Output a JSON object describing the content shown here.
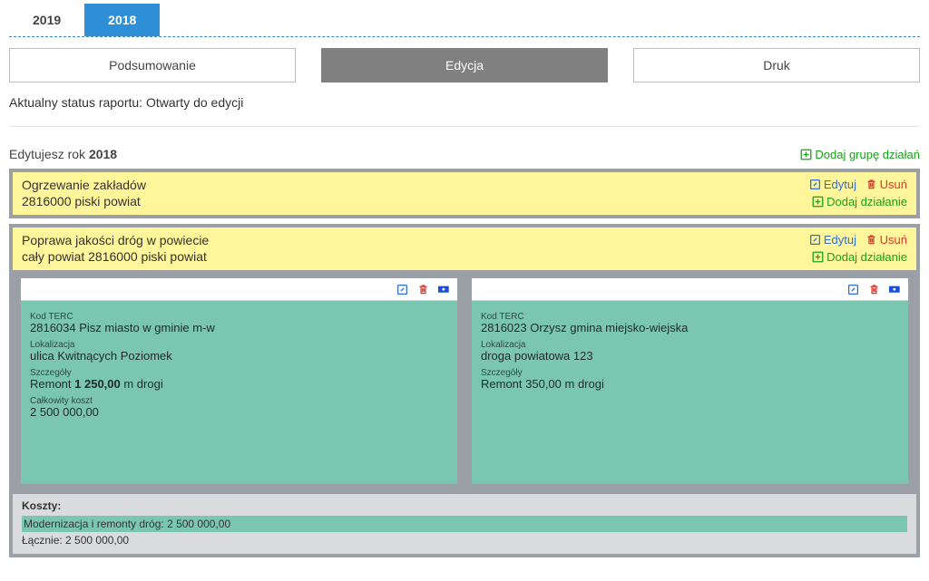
{
  "year_tabs": {
    "inactive": "2019",
    "active": "2018"
  },
  "modes": {
    "summary": "Podsumowanie",
    "edit": "Edycja",
    "print": "Druk"
  },
  "status": {
    "label": "Aktualny status raportu:",
    "value": "Otwarty do edycji"
  },
  "edit_year": {
    "prefix": "Edytujesz rok ",
    "year": "2018"
  },
  "actions": {
    "add_group": "Dodaj grupę działań",
    "edit": "Edytuj",
    "delete": "Usuń",
    "add_action": "Dodaj działanie"
  },
  "group1": {
    "line1": "Ogrzewanie zakładów",
    "line2": "2816000 piski powiat"
  },
  "group2": {
    "line1": "Poprawa jakości dróg w powiecie",
    "line2": "cały powiat 2816000 piski powiat"
  },
  "labels": {
    "terc": "Kod TERC",
    "loc": "Lokalizacja",
    "details": "Szczegóły",
    "total_cost": "Całkowity koszt"
  },
  "card1": {
    "terc": "2816034 Pisz miasto w gminie m-w",
    "loc": "ulica Kwitnących Poziomek",
    "details_prefix": "Remont ",
    "details_bold": "1 250,00",
    "details_suffix": " m drogi",
    "total_cost": "2 500 000,00"
  },
  "card2": {
    "terc": "2816023 Orzysz gmina miejsko-wiejska",
    "loc": "droga powiatowa 123",
    "details": "Remont 350,00 m drogi"
  },
  "costs": {
    "title": "Koszty:",
    "bar": "Modernizacja i remonty dróg: 2 500 000,00",
    "total": "Łącznie: 2 500 000,00"
  }
}
